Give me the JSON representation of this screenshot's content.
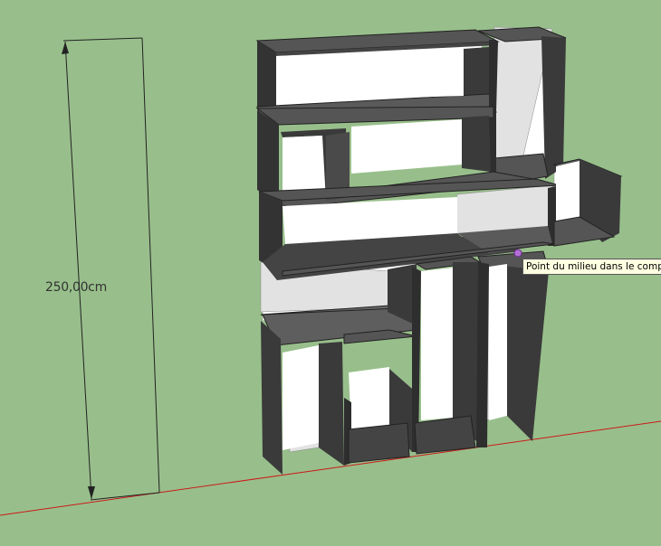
{
  "viewport": {
    "background_color": "#98bf8b",
    "dimension_label": "250,00cm",
    "tooltip_text": "Point du milieu dans le composa",
    "inference_point_color": "#b36fd6",
    "ground_axis_color": "#cc1a1a",
    "shelf_frame_color": "#3d3d3d",
    "shelf_inner_color": "#ffffff"
  }
}
